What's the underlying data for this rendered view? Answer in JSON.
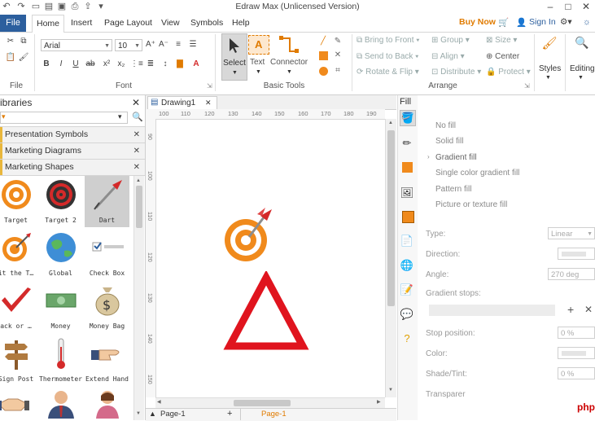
{
  "app": {
    "title": "Edraw Max (Unlicensed Version)"
  },
  "tabs": {
    "file": "File",
    "items": [
      "Home",
      "Insert",
      "Page Layout",
      "View",
      "Symbols",
      "Help"
    ],
    "buy_now": "Buy Now",
    "sign_in": "Sign In"
  },
  "ribbon": {
    "file_group": "File",
    "font": {
      "name": "Arial",
      "size": "10",
      "group": "Font"
    },
    "basic_tools": {
      "select": "Select",
      "text": "Text",
      "connector": "Connector",
      "group": "Basic Tools"
    },
    "arrange": {
      "bring_to_front": "Bring to Front",
      "send_to_back": "Send to Back",
      "rotate_flip": "Rotate & Flip",
      "group": "Group",
      "align": "Align",
      "distribute": "Distribute",
      "size": "Size",
      "center": "Center",
      "protect": "Protect",
      "group_label": "Arrange"
    },
    "styles": "Styles",
    "editing": "Editing"
  },
  "libraries": {
    "title": "ibraries",
    "categories": [
      "Presentation Symbols",
      "Marketing Diagrams",
      "Marketing Shapes"
    ],
    "shapes": [
      [
        "Target",
        "Target 2",
        "Dart"
      ],
      [
        "it the T…",
        "Global",
        "Check Box"
      ],
      [
        "ack or …",
        "Money",
        "Money Bag"
      ],
      [
        "Sign Post",
        "Thermometer",
        "Extend Hand"
      ]
    ]
  },
  "document": {
    "tab": "Drawing1",
    "hruler": [
      "100",
      "110",
      "120",
      "130",
      "140",
      "150",
      "160",
      "170",
      "180",
      "190"
    ],
    "vruler": [
      "90",
      "100",
      "110",
      "120",
      "130",
      "140",
      "150"
    ],
    "page_label": "Page-1",
    "page_tab": "Page-1"
  },
  "fill": {
    "title": "Fill",
    "options": [
      "No fill",
      "Solid fill",
      "Gradient fill",
      "Single color gradient fill",
      "Pattern fill",
      "Picture or texture fill"
    ],
    "selected": "Gradient fill",
    "type_label": "Type:",
    "type_value": "Linear",
    "direction_label": "Direction:",
    "angle_label": "Angle:",
    "angle_value": "270 deg",
    "gradient_stops_label": "Gradient stops:",
    "stop_position_label": "Stop position:",
    "stop_position_value": "0 %",
    "color_label": "Color:",
    "shade_label": "Shade/Tint:",
    "shade_value": "0 %",
    "transparency_label": "Transparer"
  },
  "colors": {
    "accent": "#2c5f9e",
    "buy_now": "#e07b00",
    "dart_red": "#d42a2a",
    "target_orange": "#f08a1c"
  }
}
